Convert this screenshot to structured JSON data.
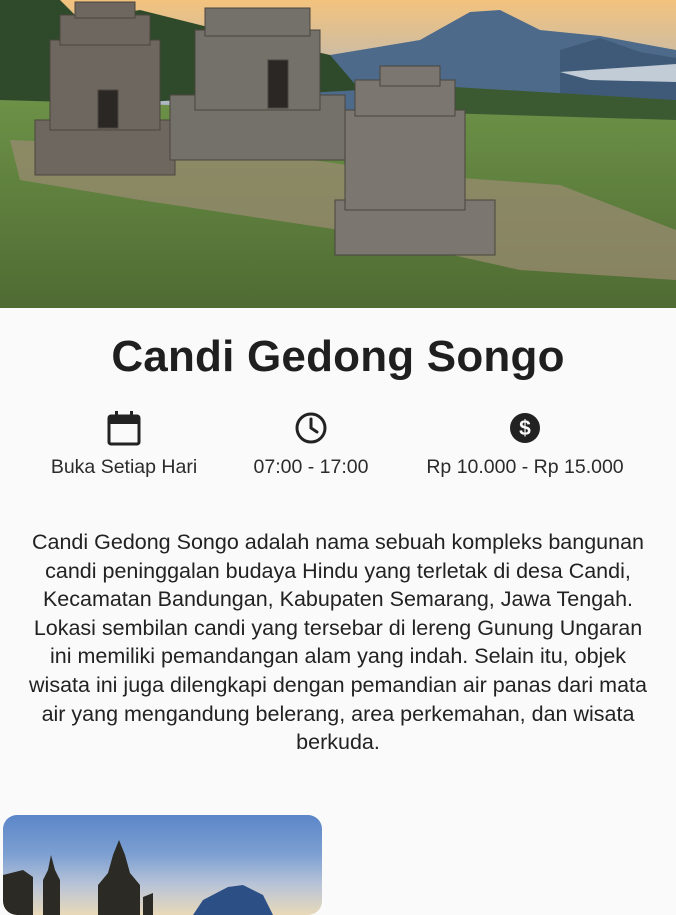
{
  "title": "Candi Gedong Songo",
  "info": [
    {
      "icon": "calendar-icon",
      "label": "Buka Setiap Hari"
    },
    {
      "icon": "clock-icon",
      "label": "07:00 - 17:00"
    },
    {
      "icon": "dollar-icon",
      "label": "Rp 10.000 - Rp 15.000"
    }
  ],
  "description": "Candi Gedong Songo adalah nama sebuah kompleks bangunan candi peninggalan budaya Hindu yang terletak di desa Candi, Kecamatan Bandungan, Kabupaten Semarang, Jawa Tengah. Lokasi sembilan candi yang tersebar di lereng Gunung Ungaran ini memiliki pemandangan alam yang indah. Selain itu, objek wisata ini juga dilengkapi dengan pemandian air panas dari mata air yang mengandung belerang, area perkemahan, dan wisata berkuda.",
  "colors": {
    "icon": "#222222",
    "background": "#fafafa"
  }
}
